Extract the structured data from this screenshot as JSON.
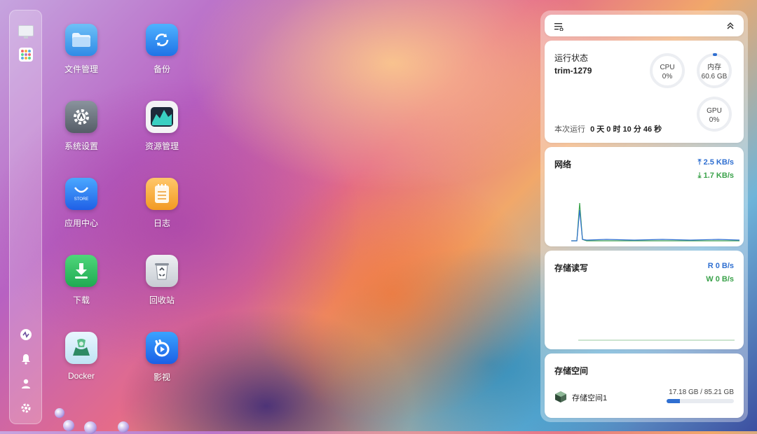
{
  "apps": [
    {
      "label": "文件管理",
      "icon": "folder-icon"
    },
    {
      "label": "备份",
      "icon": "backup-sync-icon"
    },
    {
      "label": "系统设置",
      "icon": "settings-gear-icon"
    },
    {
      "label": "资源管理",
      "icon": "resource-monitor-icon"
    },
    {
      "label": "应用中心",
      "icon": "app-store-icon",
      "sub": "STORE"
    },
    {
      "label": "日志",
      "icon": "log-notepad-icon"
    },
    {
      "label": "下载",
      "icon": "download-icon"
    },
    {
      "label": "回收站",
      "icon": "recycle-bin-icon"
    },
    {
      "label": "Docker",
      "icon": "docker-icon"
    },
    {
      "label": "影视",
      "icon": "video-icon"
    }
  ],
  "status": {
    "title": "运行状态",
    "host": "trim-1279",
    "cpu_label": "CPU",
    "cpu_value": "0%",
    "mem_label": "内存",
    "mem_value": "60.6 GB",
    "gpu_label": "GPU",
    "gpu_value": "0%",
    "uptime_label": "本次运行",
    "uptime_value": "0 天 0 时 10 分 46 秒"
  },
  "network": {
    "title": "网络",
    "upload": "2.5 KB/s",
    "download": "1.7 KB/s",
    "colors": {
      "upload": "#2f6fd1",
      "download": "#3aa24a"
    }
  },
  "disk_io": {
    "title": "存储读写",
    "read_label": "R",
    "read_value": "0 B/s",
    "write_label": "W",
    "write_value": "0 B/s"
  },
  "storage": {
    "title": "存储空间",
    "volume_name": "存储空间1",
    "usage": "17.18 GB / 85.21 GB",
    "used_fraction": 0.2
  }
}
